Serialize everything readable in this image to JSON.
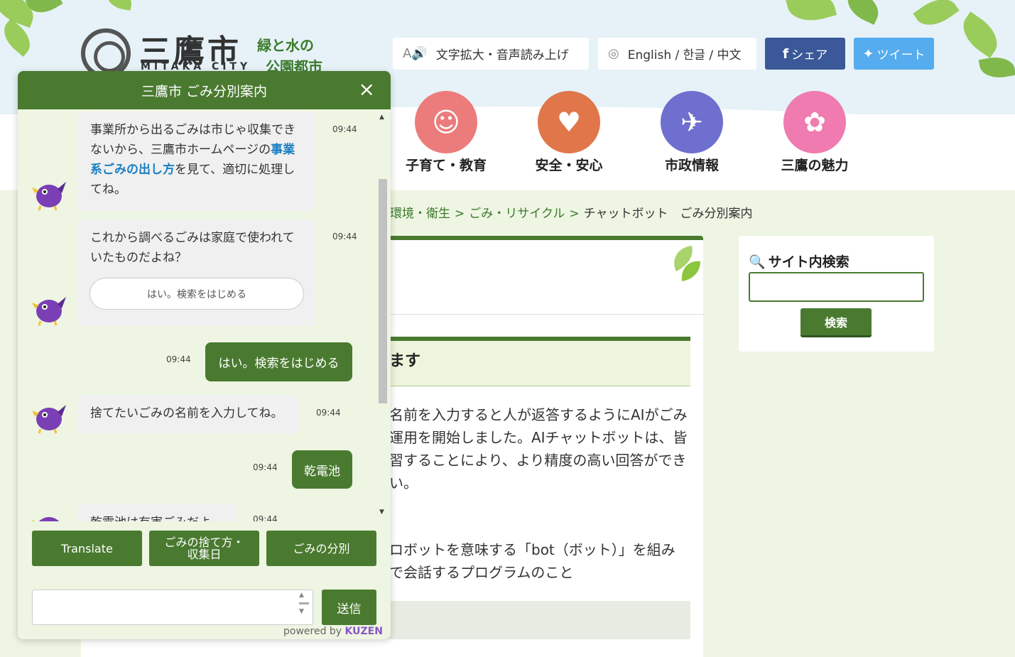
{
  "site": {
    "logo_name": "三鷹市",
    "logo_roman": "MITAKA CITY",
    "logo_tag_line1": "緑と水の",
    "logo_tag_line2": "公園都市"
  },
  "toolbar": {
    "accessibility_label": "文字拡大・音声読み上げ",
    "language_label": "English / 한글 / 中文",
    "share_label": "シェア",
    "tweet_label": "ツイート"
  },
  "nav": [
    {
      "label": "子育て・教育",
      "color": "#ec7b7b",
      "icon": "baby-face-icon"
    },
    {
      "label": "安全・安心",
      "color": "#e0764a",
      "icon": "heart-icon"
    },
    {
      "label": "市政情報",
      "color": "#6f6fcf",
      "icon": "bird-icon"
    },
    {
      "label": "三鷹の魅力",
      "color": "#f07bb0",
      "icon": "flower-icon"
    }
  ],
  "breadcrumb": {
    "item1": "環境・衛生",
    "item2": "ごみ・リサイクル",
    "sep": ">",
    "current": "チャットボット　ごみ分別案内"
  },
  "main": {
    "heading_partial": "ます",
    "para1_line1": "名前を入力すると人が返答するようにAIがごみ",
    "para1_line2": "運用を開始しました。AIチャットボットは、皆",
    "para1_line3": "習することにより、より精度の高い回答ができ",
    "para1_line4": "い。",
    "para2_line1": "ロボットを意味する「bot（ボット）」を組み",
    "para2_line2": "で会話するプログラムのこと"
  },
  "search": {
    "title": "サイト内検索",
    "input_value": "",
    "button_label": "検索"
  },
  "chat": {
    "title": "三鷹市 ごみ分別案内",
    "close_glyph": "×",
    "messages": [
      {
        "pre": "事業所から出るごみは市じゃ収集できないから、三鷹市ホームページの",
        "link": "事業系ごみの出し方",
        "post": "を見て、適切に処理してね。",
        "time": "09:44"
      },
      {
        "text": "これから調べるごみは家庭で使われていたものだよね？",
        "quick_reply": "はい。検索をはじめる",
        "time": "09:44"
      },
      {
        "user_text": "はい。検索をはじめる",
        "time": "09:44"
      },
      {
        "text": "捨てたいごみの名前を入力してね。",
        "time": "09:44"
      },
      {
        "user_text": "乾電池",
        "time": "09:44"
      },
      {
        "text": "乾電池は有害ごみだよ",
        "time": "09:44"
      }
    ],
    "buttons": {
      "translate": "Translate",
      "schedule_line1": "ごみの捨て方・",
      "schedule_line2": "収集日",
      "sorting": "ごみの分別",
      "send": "送信"
    },
    "input_value": "",
    "powered_prefix": "powered by",
    "powered_brand": "KUZEN"
  }
}
